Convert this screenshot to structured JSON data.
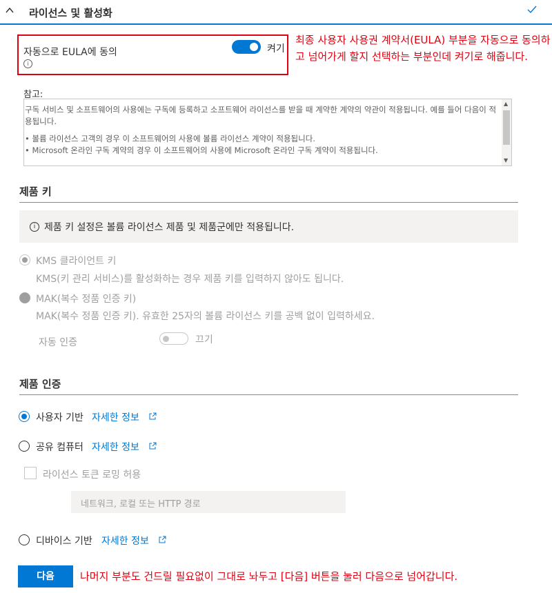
{
  "header": {
    "title": "라이선스 및 활성화"
  },
  "eula": {
    "label": "자동으로 EULA에 동의",
    "toggle_label": "켜기",
    "info_icon_glyph": "i",
    "annotation": "최종 사용자 사용권 계약서(EULA) 부분을 자동으로 동의하고 넘어가게 할지 선택하는 부분인데 켜기로 해줍니다."
  },
  "note": {
    "label": "참고:",
    "line1": "구독 서비스 및 소프트웨어의 사용에는 구독에 등록하고 소프트웨어 라이선스를 받을 때 계약한 계약의 약관이 적용됩니다. 예를 들어 다음이 적용됩니다.",
    "line2": "• 볼륨 라이선스 고객의 경우 이 소프트웨어의 사용에 볼륨 라이선스 계약이 적용됩니다.",
    "line3": "• Microsoft 온라인 구독 계약의 경우 이 소프트웨어의 사용에 Microsoft 온라인 구독 계약이 적용됩니다."
  },
  "product_key": {
    "section_title": "제품 키",
    "info_text": "제품 키 설정은 볼륨 라이선스 제품 및 제품군에만 적용됩니다.",
    "kms_label": "KMS 클라이언트 키",
    "kms_desc": "KMS(키 관리 서비스)를 활성화하는 경우 제품 키를 입력하지 않아도 됩니다.",
    "mak_label": "MAK(복수 정품 인증 키)",
    "mak_desc": "MAK(복수 정품 인증 키). 유효한 25자의 볼륨 라이선스 키를 공백 없이 입력하세요.",
    "auto_activation_label": "자동 인증",
    "auto_activation_toggle": "끄기"
  },
  "activation": {
    "section_title": "제품 인증",
    "options": [
      {
        "label": "사용자 기반",
        "link": "자세한 정보",
        "selected": true
      },
      {
        "label": "공유 컴퓨터",
        "link": "자세한 정보",
        "selected": false
      },
      {
        "label": "디바이스 기반",
        "link": "자세한 정보",
        "selected": false
      }
    ],
    "roaming_label": "라이선스 토큰 로밍 허용",
    "network_placeholder": "네트워크, 로컬 또는 HTTP 경로"
  },
  "footer": {
    "next_label": "다음",
    "annotation": "나머지 부분도 건드릴 필요없이 그대로 놔두고 [다음] 버튼을 눌러 다음으로 넘어갑니다."
  },
  "colors": {
    "accent": "#0078d4",
    "annotation_red": "#e0000f",
    "disabled": "#a19f9d"
  }
}
